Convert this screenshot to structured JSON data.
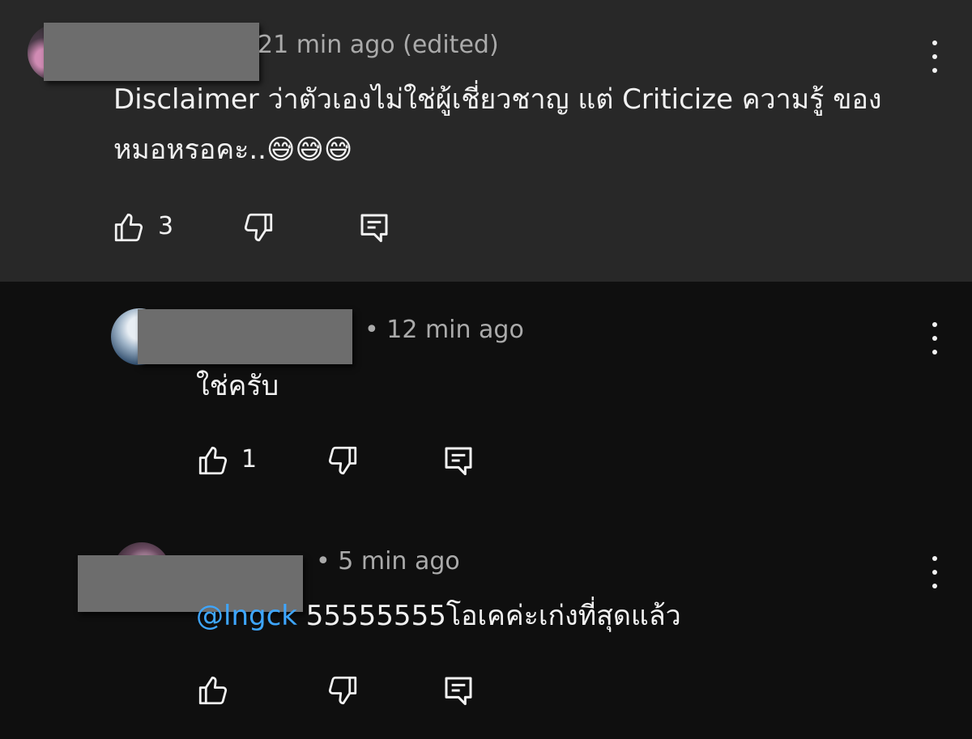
{
  "comments": [
    {
      "timestamp": "21 min ago (edited)",
      "text": "Disclaimer ว่าตัวเองไม่ใช่ผู้เชี่ยวชาญ แต่ Criticize ความรู้ ของหมอหรอคะ..😅😅😅",
      "like_count": "3"
    },
    {
      "timestamp": "• 12 min ago",
      "text": "ใช่ครับ",
      "like_count": "1"
    },
    {
      "timestamp": "• 5 min ago",
      "mention": "@lngck",
      "text": " 55555555โอเคค่ะเก่งที่สุดแล้ว",
      "like_count": ""
    }
  ],
  "icons": {
    "like": "thumbs-up-icon",
    "dislike": "thumbs-down-icon",
    "reply": "reply-icon",
    "more": "more-vert-icon"
  },
  "colors": {
    "top_comment_bg": "#282828",
    "page_bg": "#0f0f0f",
    "mention": "#3ea6ff"
  }
}
